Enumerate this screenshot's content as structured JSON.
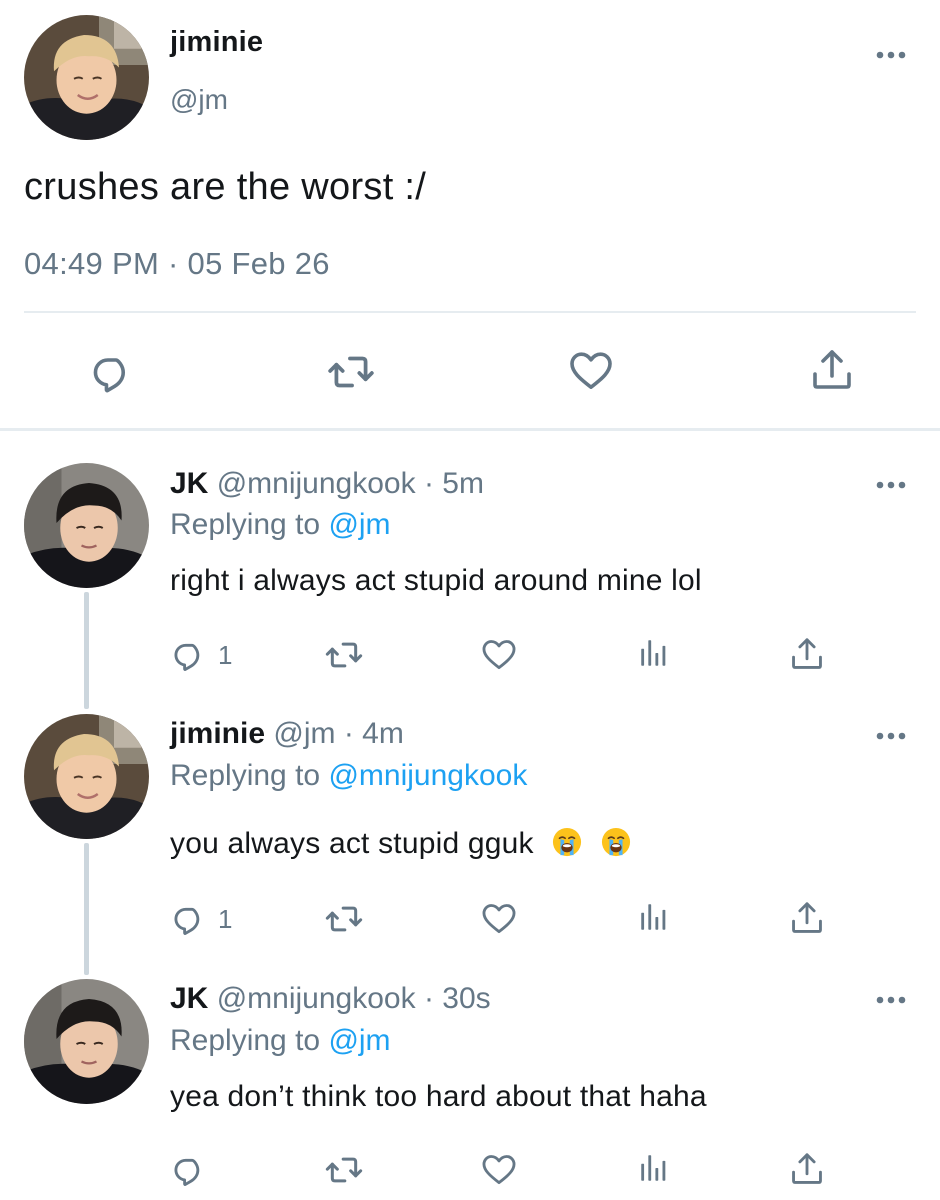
{
  "main_tweet": {
    "author_name": "jiminie",
    "author_handle": "@jm",
    "text": "crushes are the worst :/",
    "timestamp": "04:49 PM · 05 Feb 26",
    "avatar": "avatar-jiminie",
    "actions": [
      "reply-icon",
      "retweet-icon",
      "like-icon",
      "share-icon"
    ]
  },
  "replies": [
    {
      "author_name": "JK",
      "author_handle": "@mnijungkook",
      "time": "· 5m",
      "replying_prefix": "Replying to ",
      "replying_to": "@jm",
      "text": "right i always act stupid around mine lol",
      "reply_count": "1",
      "avatar": "avatar-jk"
    },
    {
      "author_name": "jiminie",
      "author_handle": "@jm",
      "time": "· 4m",
      "replying_prefix": "Replying to ",
      "replying_to": "@mnijungkook",
      "text": "you always act stupid gguk",
      "emojis": [
        "loudly-crying-face",
        "loudly-crying-face"
      ],
      "reply_count": "1",
      "avatar": "avatar-jiminie"
    },
    {
      "author_name": "JK",
      "author_handle": "@mnijungkook",
      "time": "· 30s",
      "replying_prefix": "Replying to ",
      "replying_to": "@jm",
      "text": "yea don’t think too hard about that haha",
      "reply_count": "",
      "avatar": "avatar-jk"
    }
  ],
  "colors": {
    "text": "#14171a",
    "secondary": "#657786",
    "link": "#1da1f2",
    "divider": "#e6ecf0",
    "thread_line": "#ccd6dd"
  }
}
